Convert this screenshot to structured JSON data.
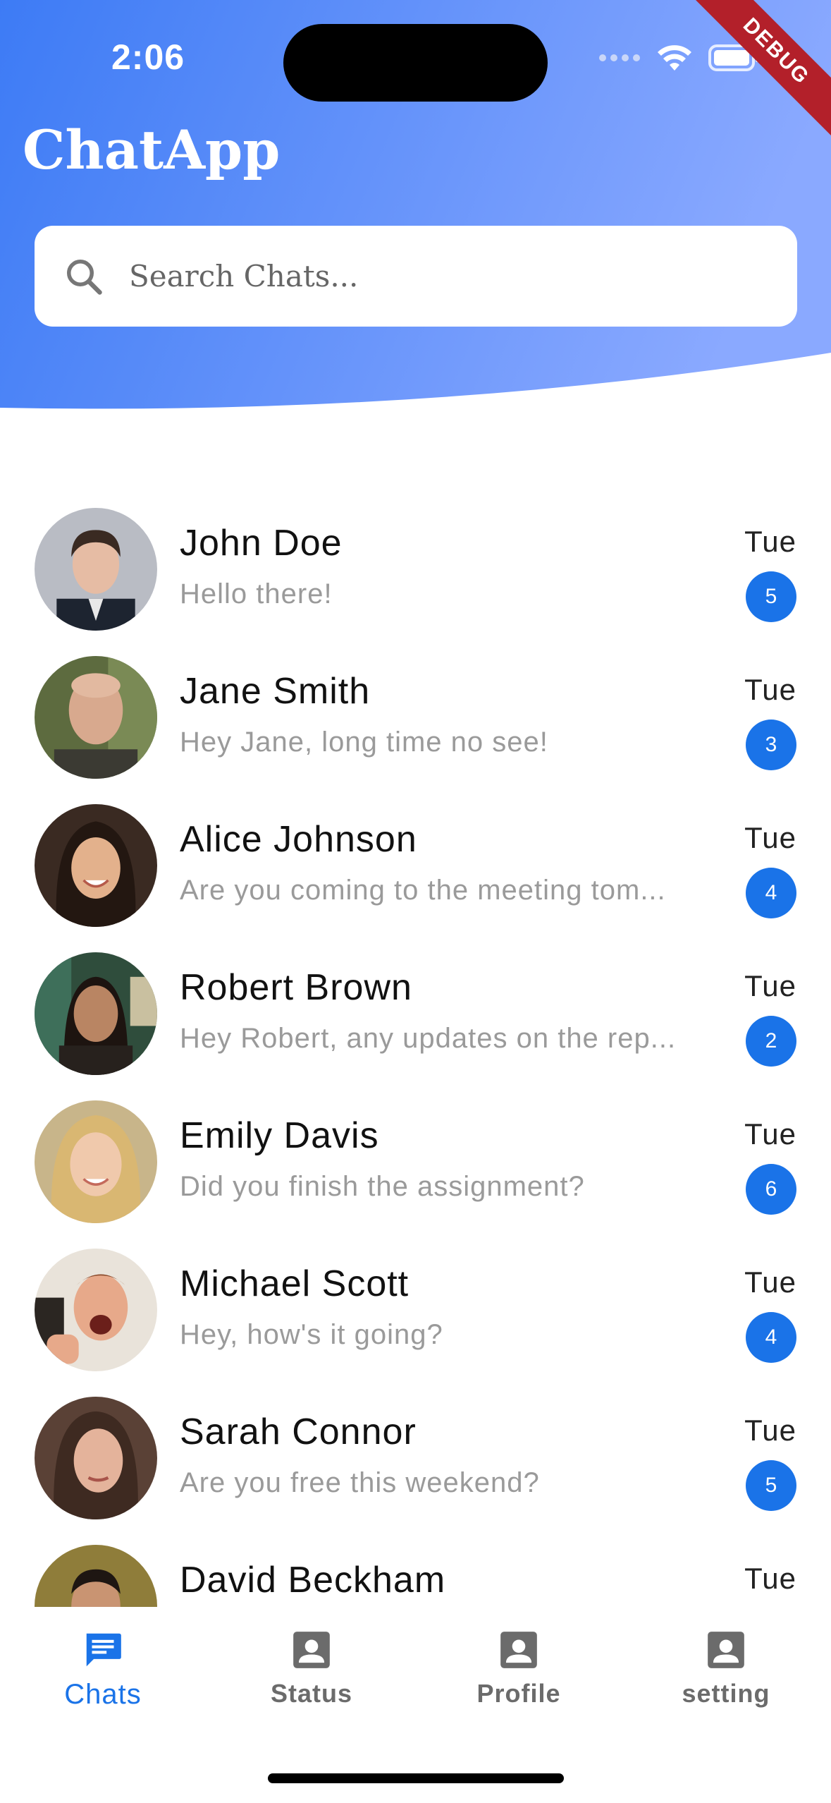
{
  "status_bar": {
    "time": "2:06",
    "debug_label": "DEBUG"
  },
  "app": {
    "title": "ChatApp"
  },
  "search": {
    "placeholder": "Search Chats..."
  },
  "colors": {
    "header_gradient_start": "#3d7bf5",
    "header_gradient_end": "#8aa9ff",
    "accent": "#1a73e8",
    "muted_text": "#9a9a9a"
  },
  "chats": [
    {
      "name": "John Doe",
      "preview": "Hello there!",
      "day": "Tue",
      "unread": "5",
      "avatar_icon": "avatar-john-doe"
    },
    {
      "name": "Jane Smith",
      "preview": "Hey Jane, long time no see!",
      "day": "Tue",
      "unread": "3",
      "avatar_icon": "avatar-jane-smith"
    },
    {
      "name": "Alice Johnson",
      "preview": "Are you coming to the meeting tom...",
      "day": "Tue",
      "unread": "4",
      "avatar_icon": "avatar-alice-johnson"
    },
    {
      "name": "Robert Brown",
      "preview": "Hey Robert, any updates on the rep...",
      "day": "Tue",
      "unread": "2",
      "avatar_icon": "avatar-robert-brown"
    },
    {
      "name": "Emily Davis",
      "preview": "Did you finish the assignment?",
      "day": "Tue",
      "unread": "6",
      "avatar_icon": "avatar-emily-davis"
    },
    {
      "name": "Michael Scott",
      "preview": "Hey, how's it going?",
      "day": "Tue",
      "unread": "4",
      "avatar_icon": "avatar-michael-scott"
    },
    {
      "name": "Sarah Connor",
      "preview": "Are you free this weekend?",
      "day": "Tue",
      "unread": "5",
      "avatar_icon": "avatar-sarah-connor"
    },
    {
      "name": "David Beckham",
      "day": "Tue",
      "avatar_icon": "avatar-david-beckham"
    }
  ],
  "bottom_nav": {
    "items": [
      {
        "label": "Chats",
        "icon": "chat-icon",
        "active": true
      },
      {
        "label": "Status",
        "icon": "person-icon",
        "active": false
      },
      {
        "label": "Profile",
        "icon": "person-icon",
        "active": false
      },
      {
        "label": "setting",
        "icon": "person-icon",
        "active": false
      }
    ]
  }
}
